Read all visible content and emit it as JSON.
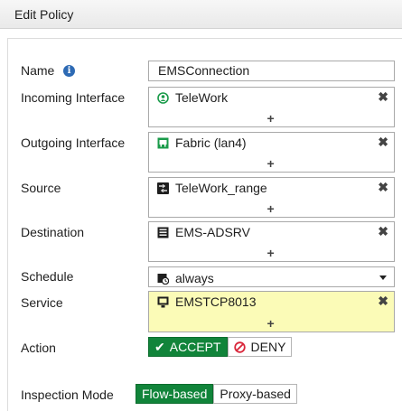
{
  "header": {
    "title": "Edit Policy"
  },
  "form": {
    "name": {
      "label": "Name",
      "value": "EMSConnection"
    },
    "incoming": {
      "label": "Incoming Interface",
      "item": "TeleWork"
    },
    "outgoing": {
      "label": "Outgoing Interface",
      "item": "Fabric (lan4)"
    },
    "source": {
      "label": "Source",
      "item": "TeleWork_range"
    },
    "destination": {
      "label": "Destination",
      "item": "EMS-ADSRV"
    },
    "schedule": {
      "label": "Schedule",
      "value": "always"
    },
    "service": {
      "label": "Service",
      "item": "EMSTCP8013",
      "highlight_color": "#fbfbb7"
    },
    "action": {
      "label": "Action",
      "accept": "ACCEPT",
      "deny": "DENY",
      "selected": "ACCEPT"
    },
    "inspection": {
      "label": "Inspection Mode",
      "flow": "Flow-based",
      "proxy": "Proxy-based",
      "selected": "Flow-based"
    }
  },
  "glyphs": {
    "remove": "✖",
    "add": "+",
    "check": "✔",
    "info": "i"
  },
  "colors": {
    "accent_green": "#11843a",
    "info_blue": "#2d6ab4",
    "deny_red": "#d9263a"
  }
}
